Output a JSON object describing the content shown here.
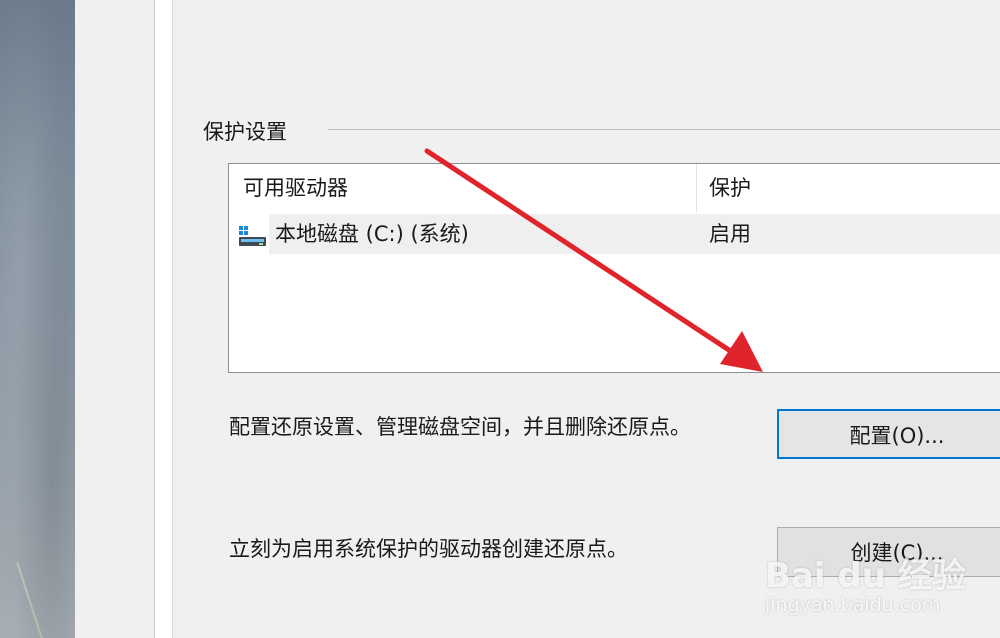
{
  "protection_group": {
    "title": "保护设置",
    "columns": [
      "可用驱动器",
      "保护"
    ],
    "rows": [
      {
        "drive": "本地磁盘 (C:) (系统)",
        "protection": "启用",
        "icon": "drive-icon"
      }
    ]
  },
  "configure": {
    "description": "配置还原设置、管理磁盘空间，并且删除还原点。",
    "button_label": "配置(O)..."
  },
  "create": {
    "description": "立刻为启用系统保护的驱动器创建还原点。",
    "button_label": "创建(C)..."
  },
  "annotation": {
    "arrow_color": "#e0242b"
  },
  "watermark": {
    "logo": "Bai du 经验",
    "url": "jingyan.baidu.com"
  },
  "colors": {
    "accent": "#0078d7",
    "dialog_bg": "#f0f0f0",
    "list_bg": "#ffffff"
  }
}
